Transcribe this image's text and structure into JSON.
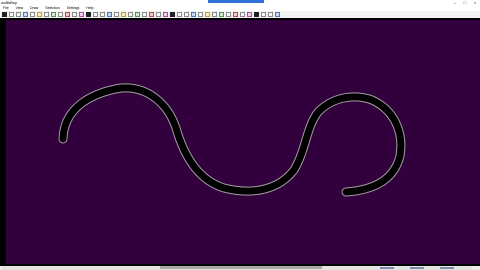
{
  "app": {
    "title": "ooBkBoy"
  },
  "menu": [
    "File",
    "View",
    "Draw",
    "Selection",
    "Settings",
    "Help"
  ],
  "window_controls": {
    "minimize": "–",
    "maximize": "□",
    "close": "×"
  },
  "toolbar": {
    "buttons": [
      "save-icon",
      "open-icon",
      "new-icon",
      "undo-icon",
      "redo-icon",
      "cut-icon",
      "copy-icon",
      "paste-icon",
      "select-icon",
      "move-icon",
      "rotate-icon",
      "scale-icon",
      "line-icon",
      "curve-icon",
      "arc-icon",
      "circle-icon",
      "rect-icon",
      "polygon-icon",
      "text-icon",
      "pen-icon",
      "eraser-icon",
      "fill-icon",
      "picker-icon",
      "grid-icon",
      "layer-icon",
      "group-icon",
      "ungroup-icon",
      "align-icon",
      "distribute-icon",
      "flip-icon",
      "mirror-icon",
      "zoom-in-icon",
      "zoom-out-icon",
      "zoom-fit-icon",
      "hand-icon",
      "lock-icon",
      "unlock-icon",
      "settings-icon",
      "help-icon",
      "color-icon"
    ]
  },
  "canvas": {
    "background": "#33003e",
    "stroke_color": "#000000",
    "outline_color": "#a0a0a0"
  }
}
